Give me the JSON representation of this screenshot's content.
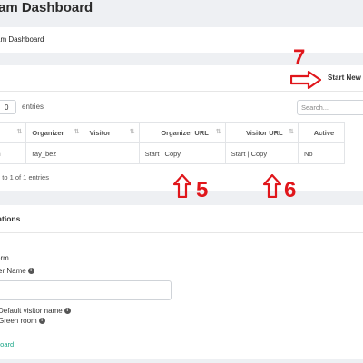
{
  "header": {
    "title": "am Dashboard"
  },
  "breadcrumb": {
    "text": "am Dashboard"
  },
  "card1": {
    "start_new": "Start New",
    "entries_value": "0",
    "entries_label": "entries",
    "search_placeholder": "Search...",
    "columns": [
      "om",
      "Organizer",
      "Visitor",
      "Organizer URL",
      "Visitor URL",
      "Active"
    ],
    "row": {
      "room": "wan",
      "organizer": "ray_bez",
      "visitor": "",
      "organizer_url_start": "Start",
      "organizer_url_copy": "Copy",
      "visitor_url_start": "Start",
      "visitor_url_copy": "Copy",
      "active": "No"
    },
    "info": "1 to 1 of 1 entries"
  },
  "card2": {
    "title": "rations",
    "form_label": "orm",
    "organizer_name_label": "zer Name",
    "checkbox1": "Default visitor name",
    "checkbox2": "Green room",
    "dashboard_link": "board"
  },
  "annotations": {
    "a5": "5",
    "a6": "6",
    "a7": "7"
  },
  "colors": {
    "annotation": "#e0161b",
    "link": "#1aa687"
  }
}
